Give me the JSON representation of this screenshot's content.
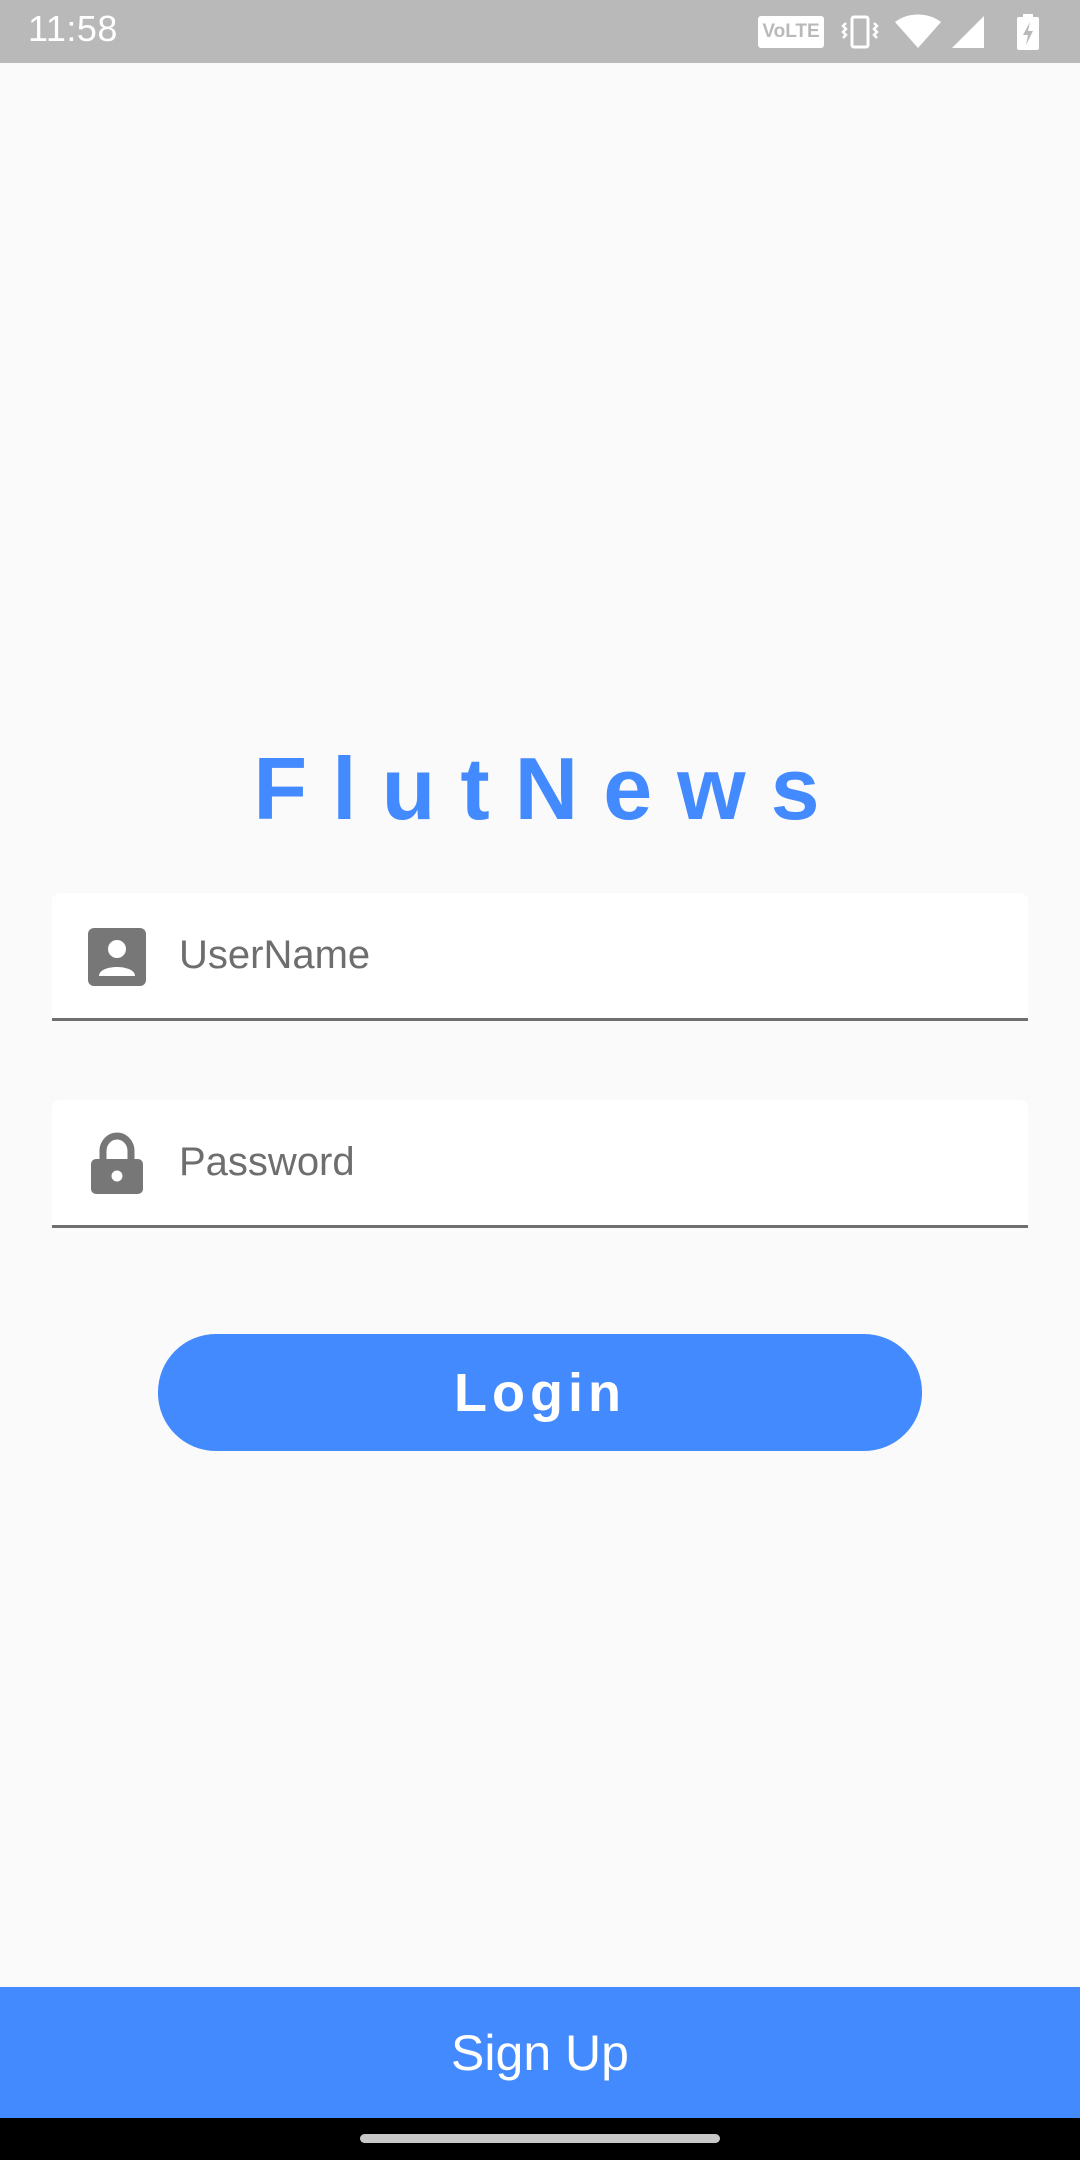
{
  "status_bar": {
    "time": "11:58",
    "network_badge": "VoLTE",
    "icons": [
      "volte-icon",
      "vibrate-icon",
      "wifi-icon",
      "signal-icon",
      "battery-charging-icon"
    ]
  },
  "app": {
    "title": "FlutNews"
  },
  "form": {
    "username": {
      "icon": "account-box-icon",
      "placeholder": "UserName",
      "value": ""
    },
    "password": {
      "icon": "lock-icon",
      "placeholder": "Password",
      "value": ""
    },
    "login_label": "Login"
  },
  "signup": {
    "label": "Sign Up"
  },
  "colors": {
    "accent": "#448aff",
    "background": "#fafafa",
    "status_bar": "#b9b9b9",
    "icon_gray": "#777777",
    "field_underline": "#6f6f6f"
  }
}
